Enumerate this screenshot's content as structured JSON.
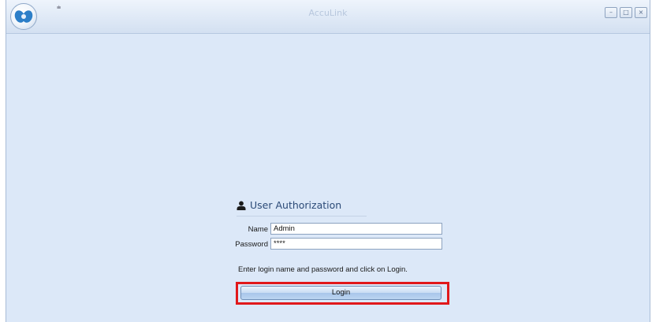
{
  "window": {
    "title": "AccuLink",
    "qat_arrow": "⩧",
    "controls": {
      "minimize": "–",
      "maximize": "□",
      "close": "×"
    }
  },
  "auth": {
    "title": "User Authorization",
    "name_label": "Name",
    "name_value": "Admin",
    "password_label": "Password",
    "password_value": "****",
    "hint": "Enter login name and password and click on Login.",
    "login_label": "Login"
  },
  "icons": {
    "app_logo": "app-logo-icon",
    "user": "user-icon"
  },
  "colors": {
    "background": "#dce8f8",
    "title_text": "#2b4a77",
    "highlight": "#e1181b",
    "logo": "#2d7fc8"
  }
}
